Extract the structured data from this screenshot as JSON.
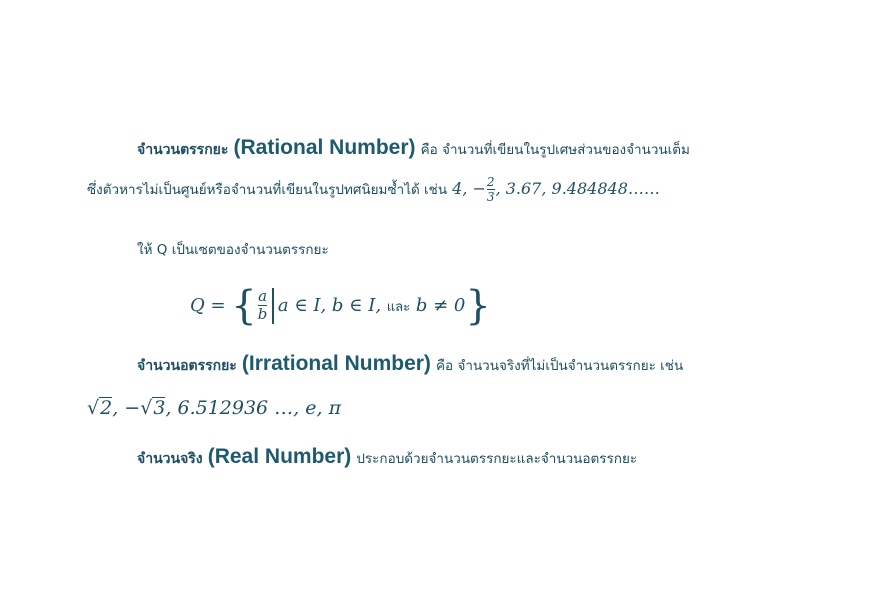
{
  "rational": {
    "thai_term": "จำนวนตรรกยะ",
    "english_term": "(Rational Number)",
    "definition_line1": "คือ จำนวนที่เขียนในรูปเศษส่วนของจำนวนเต็ม",
    "definition_line2": "ซึ่งตัวหารไม่เป็นศูนย์หรือจำนวนที่เขียนในรูปทศนิยมซ้ำได้ เช่น",
    "ex_first": "4, −",
    "ex_frac_num": "2",
    "ex_frac_den": "3",
    "ex_rest": ", 3.67, 9.484848……"
  },
  "set_def": {
    "intro": "ให้ Q เป็นเซตของจำนวนตรรกยะ",
    "lhs": "Q =",
    "frac_num": "a",
    "frac_den": "b",
    "cond": "a ∈ I,  b ∈ I,",
    "and_word": "และ",
    "cond2": "b ≠ 0",
    "lbrace": "{",
    "rbrace": "}"
  },
  "irrational": {
    "thai_term": "จำนวนอตรรกยะ",
    "english_term": "(Irrational Number)",
    "definition": "คือ จำนวนจริงที่ไม่เป็นจำนวนตรรกยะ เช่น",
    "ex_sqrt1": "2",
    "ex_sep": ",   −",
    "ex_sqrt2": "3",
    "ex_rest": ", 6.512936 …, e, π",
    "radical": "√"
  },
  "real": {
    "thai_term": "จำนวนจริง",
    "english_term": "(Real Number)",
    "definition": "ประกอบด้วยจำนวนตรรกยะและจำนวนอตรรกยะ"
  }
}
